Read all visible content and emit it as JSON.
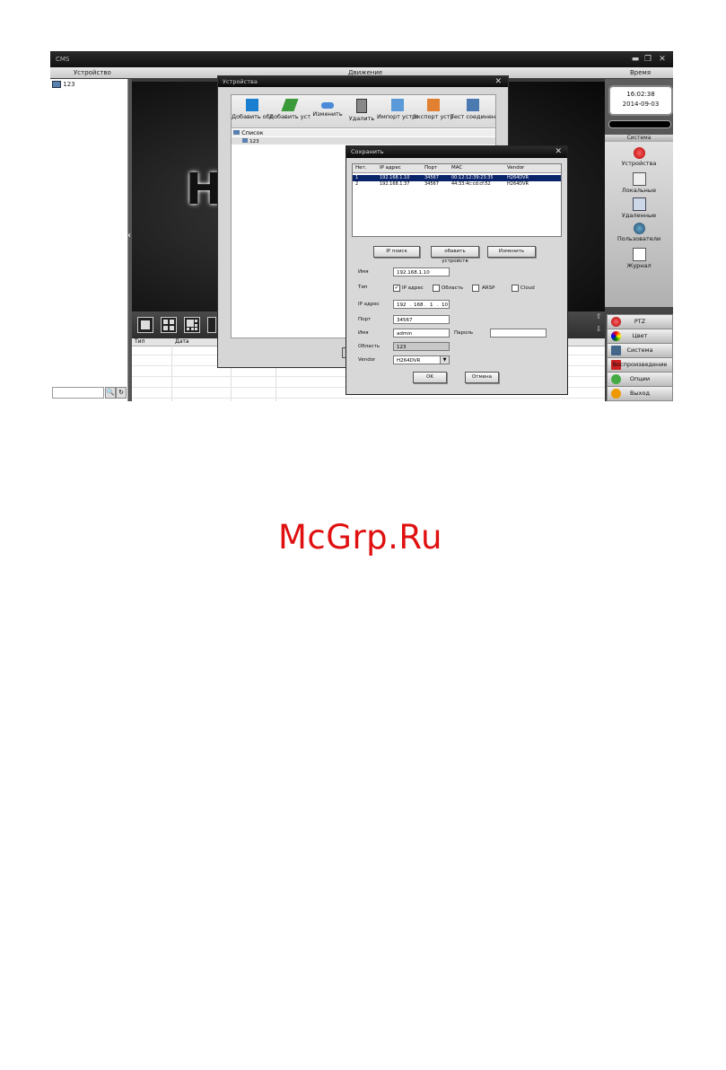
{
  "app": {
    "title": "CMS"
  },
  "menu": {
    "device": "Устройство",
    "motion": "Движение",
    "time": "Время"
  },
  "left_panel": {
    "tree_item": "123"
  },
  "log": {
    "col_type": "Тип",
    "col_date": "Дата"
  },
  "clock": {
    "time": "16:02:38",
    "date": "2014-09-03"
  },
  "system_panel": {
    "header": "Система",
    "items": [
      "Устройства",
      "Локальные",
      "Удаленные",
      "Пользователи",
      "Журнал"
    ]
  },
  "right_buttons": [
    "PTZ",
    "Цвет",
    "Система",
    "Воспроизведение",
    "Опции",
    "Выход"
  ],
  "devices_dialog": {
    "title": "Устройства",
    "toolbar": [
      "Добавить обл",
      "Добавить устр",
      "Изменить",
      "Удалить",
      "Импорт устро",
      "Экспорт устр",
      "Тест соединени"
    ],
    "tree": {
      "root": "Список",
      "child": "123"
    }
  },
  "save_dialog": {
    "title": "Сохранить",
    "columns": [
      "Нет.",
      "IP адрес",
      "Порт",
      "MAC",
      "Vendor"
    ],
    "rows": [
      [
        "1",
        "192.168.1.10",
        "34567",
        "00:12:12:39:23:35",
        "H264DVR"
      ],
      [
        "2",
        "192.168.1.37",
        "34567",
        "44:33:4c:cd:cf:52",
        "H264DVR"
      ]
    ],
    "buttons": {
      "ip_search": "IP поиск",
      "add_device": "обавить устройств",
      "edit": "Изменить"
    },
    "labels": {
      "name": "Имя",
      "type": "Тип",
      "ip": "IP адрес",
      "port": "Порт",
      "user": "Имя",
      "password": "Пароль",
      "area": "Область",
      "vendor": "Vendor"
    },
    "type_options": [
      "IP адрес",
      "Область",
      "ARSP",
      "Cloud"
    ],
    "values": {
      "name": "192.168.1.10",
      "ip": [
        "192",
        "168",
        "1",
        "10"
      ],
      "port": "34567",
      "user": "admin",
      "password": "",
      "area": "123",
      "vendor": "H264DVR"
    },
    "ok": "OK",
    "cancel": "Отмена"
  },
  "watermark": "McGrp.Ru"
}
